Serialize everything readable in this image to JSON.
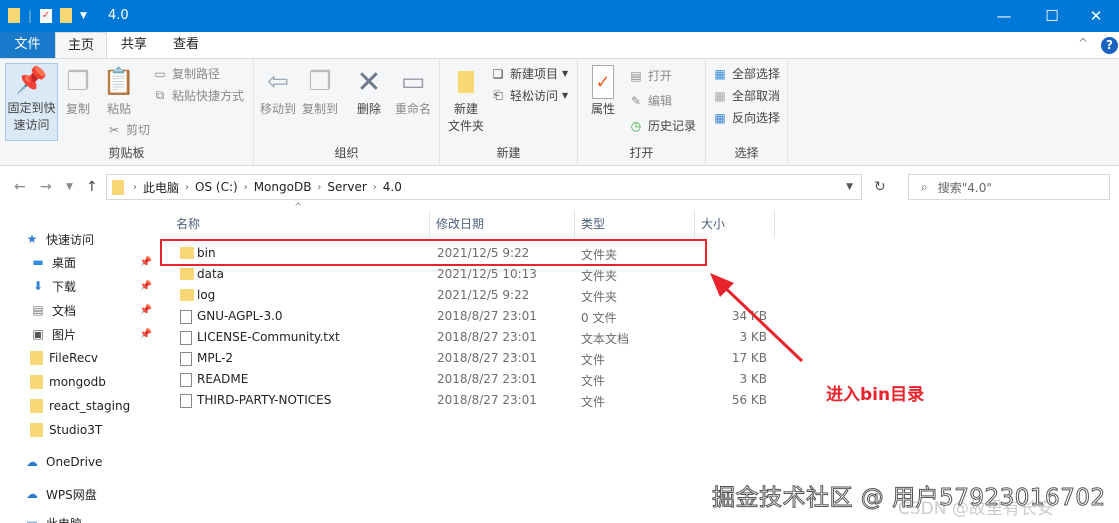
{
  "window": {
    "title": "4.0",
    "minimize": "—",
    "maximize": "☐",
    "close": "✕"
  },
  "tabs": {
    "file": "文件",
    "home": "主页",
    "share": "共享",
    "view": "查看"
  },
  "ribbon": {
    "clipboard": {
      "label": "剪贴板",
      "pin": "固定到快\n速访问",
      "pin1": "固定到快",
      "pin2": "速访问",
      "copy": "复制",
      "paste": "粘贴",
      "copy_path": "复制路径",
      "paste_shortcut": "粘贴快捷方式",
      "cut": "剪切"
    },
    "organize": {
      "label": "组织",
      "move_to": "移动到",
      "copy_to": "复制到",
      "delete": "删除",
      "rename": "重命名"
    },
    "new": {
      "label": "新建",
      "new_folder1": "新建",
      "new_folder2": "文件夹",
      "new_item": "新建项目",
      "easy_access": "轻松访问"
    },
    "open": {
      "label": "打开",
      "properties": "属性",
      "open": "打开",
      "edit": "编辑",
      "history": "历史记录"
    },
    "select": {
      "label": "选择",
      "select_all": "全部选择",
      "select_none": "全部取消",
      "invert": "反向选择"
    }
  },
  "address": {
    "crumbs": [
      "此电脑",
      "OS (C:)",
      "MongoDB",
      "Server",
      "4.0"
    ],
    "search_placeholder": "搜索\"4.0\""
  },
  "sidebar": {
    "items": [
      {
        "label": "快速访问",
        "icon": "star-icon"
      },
      {
        "label": "桌面",
        "icon": "desktop-icon",
        "pinned": true
      },
      {
        "label": "下载",
        "icon": "download-icon",
        "pinned": true
      },
      {
        "label": "文档",
        "icon": "documents-icon",
        "pinned": true
      },
      {
        "label": "图片",
        "icon": "pictures-icon",
        "pinned": true
      },
      {
        "label": "FileRecv",
        "icon": "folder-icon"
      },
      {
        "label": "mongodb",
        "icon": "folder-icon"
      },
      {
        "label": "react_staging",
        "icon": "folder-icon"
      },
      {
        "label": "Studio3T",
        "icon": "folder-icon"
      },
      {
        "label": "OneDrive",
        "icon": "cloud-icon"
      },
      {
        "label": "WPS网盘",
        "icon": "cloud-icon"
      },
      {
        "label": "此电脑",
        "icon": "computer-icon"
      }
    ]
  },
  "columns": {
    "name": "名称",
    "date": "修改日期",
    "type": "类型",
    "size": "大小"
  },
  "files": [
    {
      "name": "bin",
      "date": "2021/12/5 9:22",
      "type": "文件夹",
      "size": "",
      "folder": true
    },
    {
      "name": "data",
      "date": "2021/12/5 10:13",
      "type": "文件夹",
      "size": "",
      "folder": true
    },
    {
      "name": "log",
      "date": "2021/12/5 9:22",
      "type": "文件夹",
      "size": "",
      "folder": true
    },
    {
      "name": "GNU-AGPL-3.0",
      "date": "2018/8/27 23:01",
      "type": "0 文件",
      "size": "34 KB"
    },
    {
      "name": "LICENSE-Community.txt",
      "date": "2018/8/27 23:01",
      "type": "文本文档",
      "size": "3 KB"
    },
    {
      "name": "MPL-2",
      "date": "2018/8/27 23:01",
      "type": "文件",
      "size": "17 KB"
    },
    {
      "name": "README",
      "date": "2018/8/27 23:01",
      "type": "文件",
      "size": "3 KB"
    },
    {
      "name": "THIRD-PARTY-NOTICES",
      "date": "2018/8/27 23:01",
      "type": "文件",
      "size": "56 KB"
    }
  ],
  "annotation": "进入bin目录",
  "watermark": {
    "juejin": "掘金技术社区 @ 用户57923016702",
    "csdn": "CSDN @故里有长安"
  },
  "colors": {
    "titlebar": "#0078d7",
    "annotation": "#e8232b"
  }
}
